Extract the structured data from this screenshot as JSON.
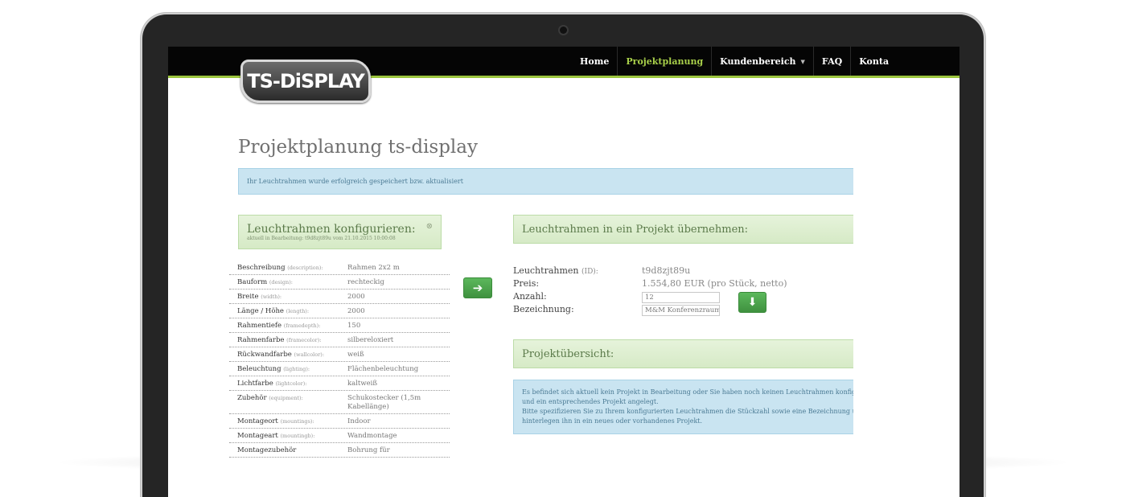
{
  "nav": {
    "logo_text": "TS-DiSPLAY",
    "items": [
      {
        "label": "Home"
      },
      {
        "label": "Projektplanung",
        "active": true
      },
      {
        "label": "Kundenbereich",
        "has_caret": true
      },
      {
        "label": "FAQ"
      },
      {
        "label": "Konta"
      }
    ],
    "accent_color": "#9bc53d"
  },
  "page": {
    "title": "Projektplanung ts-display",
    "success_message": "Ihr Leuchtrahmen wurde erfolgreich gespeichert bzw. aktualisiert"
  },
  "configure_panel": {
    "title": "Leuchtrahmen konfigurieren:",
    "subtitle": "aktuell in Bearbeitung: t9d8zjt89u vom 21.10.2015 10:00:08",
    "close_icon": "circle-close-icon"
  },
  "specs": [
    {
      "key": "Beschreibung",
      "hint": "(description):",
      "value": "Rahmen 2x2 m"
    },
    {
      "key": "Bauform",
      "hint": "(design):",
      "value": "rechteckig"
    },
    {
      "key": "Breite",
      "hint": "(width):",
      "value": "2000"
    },
    {
      "key": "Länge / Höhe",
      "hint": "(length):",
      "value": "2000"
    },
    {
      "key": "Rahmentiefe",
      "hint": "(framedepth):",
      "value": "150"
    },
    {
      "key": "Rahmenfarbe",
      "hint": "(framecolor):",
      "value": "silbereloxiert"
    },
    {
      "key": "Rückwandfarbe",
      "hint": "(wallcolor):",
      "value": "weiß"
    },
    {
      "key": "Beleuchtung",
      "hint": "(lighting):",
      "value": "Flächenbeleuchtung"
    },
    {
      "key": "Lichtfarbe",
      "hint": "(lightcolor):",
      "value": "kaltweiß"
    },
    {
      "key": "Zubehör",
      "hint": "(equipment):",
      "value": "Schukostecker (1,5m Kabellänge)"
    },
    {
      "key": "Montageort",
      "hint": "(mountings):",
      "value": "Indoor"
    },
    {
      "key": "Montageart",
      "hint": "(mountingb):",
      "value": "Wandmontage"
    },
    {
      "key": "Montagezubehör",
      "hint": "",
      "value": "Bohrung für"
    }
  ],
  "transfer_panel": {
    "title": "Leuchtrahmen in ein Projekt übernehmen:",
    "id_label": "Leuchtrahmen",
    "id_hint": "(ID):",
    "id_value": "t9d8zjt89u",
    "price_label": "Preis:",
    "price_value": "1.554,80 EUR (pro Stück, netto)",
    "qty_label": "Anzahl:",
    "qty_value": "12",
    "name_label": "Bezeichnung:",
    "name_value": "M&M Konferenzraum"
  },
  "overview_panel": {
    "title": "Projektübersicht:",
    "info_lines": [
      "Es befindet sich aktuell kein Projekt in Bearbeitung oder Sie haben noch keinen Leuchtrahmen konfiguriert",
      "und ein entsprechendes Projekt angelegt.",
      "Bitte spezifizieren Sie zu Ihrem konfigurierten Leuchtrahmen die Stückzahl sowie eine Bezeichnung und",
      "hinterlegen ihn in ein neues oder vorhandenes Projekt."
    ]
  },
  "icons": {
    "transfer": "arrow-right-icon",
    "add": "arrow-down-icon"
  }
}
